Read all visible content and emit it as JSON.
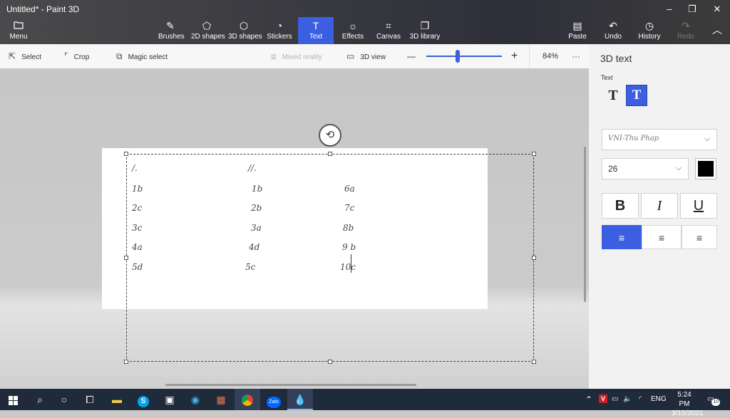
{
  "window": {
    "title": "Untitled* - Paint 3D",
    "minimize": "–",
    "restore": "❐",
    "close": "✕"
  },
  "ribbon": {
    "menu": {
      "icon": "folder-icon",
      "label": "Menu"
    },
    "tools": [
      {
        "id": "brushes",
        "icon": "brush-icon",
        "label": "Brushes"
      },
      {
        "id": "2d-shapes",
        "icon": "2d-shapes-icon",
        "label": "2D shapes"
      },
      {
        "id": "3d-shapes",
        "icon": "cube-icon",
        "label": "3D shapes"
      },
      {
        "id": "stickers",
        "icon": "sticker-icon",
        "label": "Stickers"
      },
      {
        "id": "text",
        "icon": "text-icon",
        "label": "Text",
        "selected": true
      },
      {
        "id": "effects",
        "icon": "sun-icon",
        "label": "Effects"
      },
      {
        "id": "canvas",
        "icon": "canvas-icon",
        "label": "Canvas"
      },
      {
        "id": "3d-library",
        "icon": "library-icon",
        "label": "3D library"
      }
    ],
    "paste": "Paste",
    "undo": "Undo",
    "history": "History",
    "redo": "Redo"
  },
  "toolbar": {
    "select": "Select",
    "crop": "Crop",
    "magic_select": "Magic select",
    "mixed_reality": "Mixed reality",
    "view_3d": "3D view",
    "zoom_minus": "—",
    "zoom_plus": "+",
    "zoom": "84%",
    "more": "···"
  },
  "canvas_text": {
    "col1": [
      "/.",
      "1b",
      "2c",
      "3c",
      "4a",
      "5d"
    ],
    "col2": [
      "//.",
      "1b",
      "2b",
      "3a",
      "4d",
      "5c"
    ],
    "col3": [
      "6a",
      "7c",
      "8b",
      "9 b",
      "10c"
    ]
  },
  "panel": {
    "title": "3D text",
    "text_label": "Text",
    "text_2d": "T",
    "text_3d": "T",
    "font": "VNI-Thu Phap",
    "size": "26",
    "color": "#000000",
    "bold": "B",
    "italic": "I",
    "underline": "U",
    "align_selected": "left"
  },
  "taskbar": {
    "apps": [
      "windows-icon",
      "search-icon",
      "cortana-icon",
      "task-view-icon",
      "file-explorer-icon",
      "skype-icon",
      "store-icon",
      "edge-icon",
      "office-icon",
      "chrome-icon",
      "zalo-icon",
      "paint3d-icon"
    ],
    "zalo_label": "Zalo",
    "skype_label": "S",
    "language": "ENG",
    "time": "5:24 PM",
    "date": "3/15/2021",
    "notifications": "10"
  }
}
